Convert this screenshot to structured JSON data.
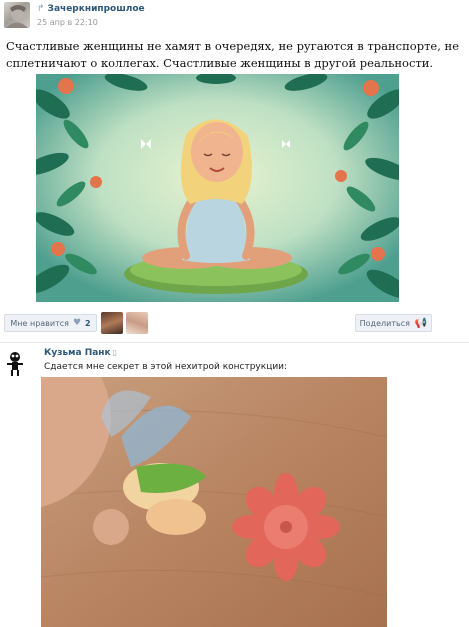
{
  "post": {
    "author": "Зачеркнипрошлое",
    "date": "25 апр в 22:10",
    "text": "Счастливые женщины не хамят в очередях, не ругаются в транспорте, не сплетничают о коллегах. Счастливые женщины в другой реальности.",
    "image_icon": "repost-icon"
  },
  "actions": {
    "like_label": "Мне нравится",
    "like_icon": "heart-icon",
    "like_count": "2",
    "share_label": "Поделиться",
    "share_icon": "megaphone-icon"
  },
  "comment": {
    "author": "Кузьма Панк",
    "device_icon": "mobile-icon",
    "text": "Сдается мне секрет в этой нехитрой конструкции:"
  },
  "colors": {
    "link": "#2b587a",
    "button_bg": "#eef1f5",
    "muted": "#999999"
  }
}
